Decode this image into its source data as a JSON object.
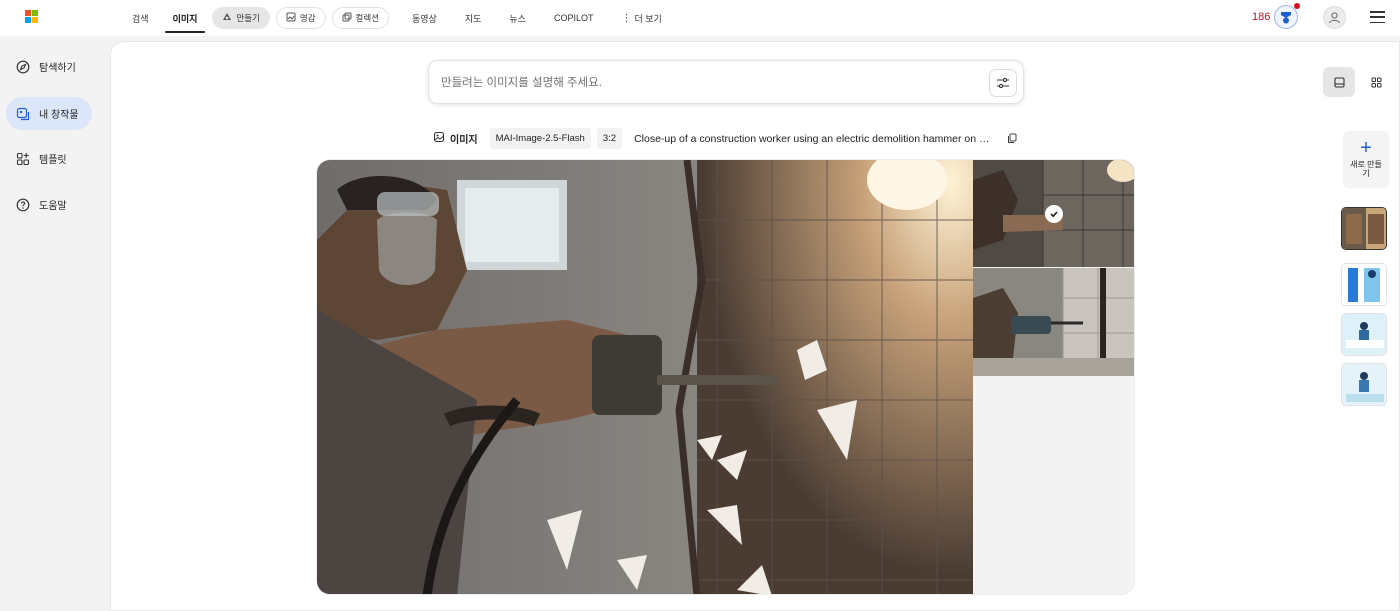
{
  "topbar": {
    "nav": [
      {
        "label": "검색",
        "type": "text"
      },
      {
        "label": "이미지",
        "type": "text",
        "active": true
      },
      {
        "label": "만들기",
        "type": "pill",
        "selected": true,
        "icon": "create-icon"
      },
      {
        "label": "영감",
        "type": "pill",
        "icon": "inspiration-icon"
      },
      {
        "label": "컬렉션",
        "type": "pill",
        "icon": "collection-icon"
      },
      {
        "label": "동영상",
        "type": "text"
      },
      {
        "label": "지도",
        "type": "text"
      },
      {
        "label": "뉴스",
        "type": "text"
      },
      {
        "label": "COPILOT",
        "type": "text"
      },
      {
        "label": "더 보기",
        "type": "text",
        "icon": "more-vertical-icon"
      }
    ],
    "points": "186",
    "colors": {
      "points": "#c50f1f",
      "accent": "#1d5fd1"
    }
  },
  "sidebar": {
    "items": [
      {
        "label": "탐색하기",
        "icon": "explore-icon"
      },
      {
        "label": "내 창작물",
        "icon": "my-creations-icon",
        "selected": true
      },
      {
        "label": "템플릿",
        "icon": "templates-icon"
      },
      {
        "label": "도움말",
        "icon": "help-icon"
      }
    ]
  },
  "prompt": {
    "placeholder": "만들려는 이미지를 설명해 주세요."
  },
  "meta": {
    "type_label": "이미지",
    "model": "MAI-Image-2.5-Flash",
    "ratio": "3:2",
    "caption": "Close-up of a construction worker using an electric demolition hammer on a tiled bathroom wall"
  },
  "right_panel": {
    "new_label": "새로 만들기"
  }
}
